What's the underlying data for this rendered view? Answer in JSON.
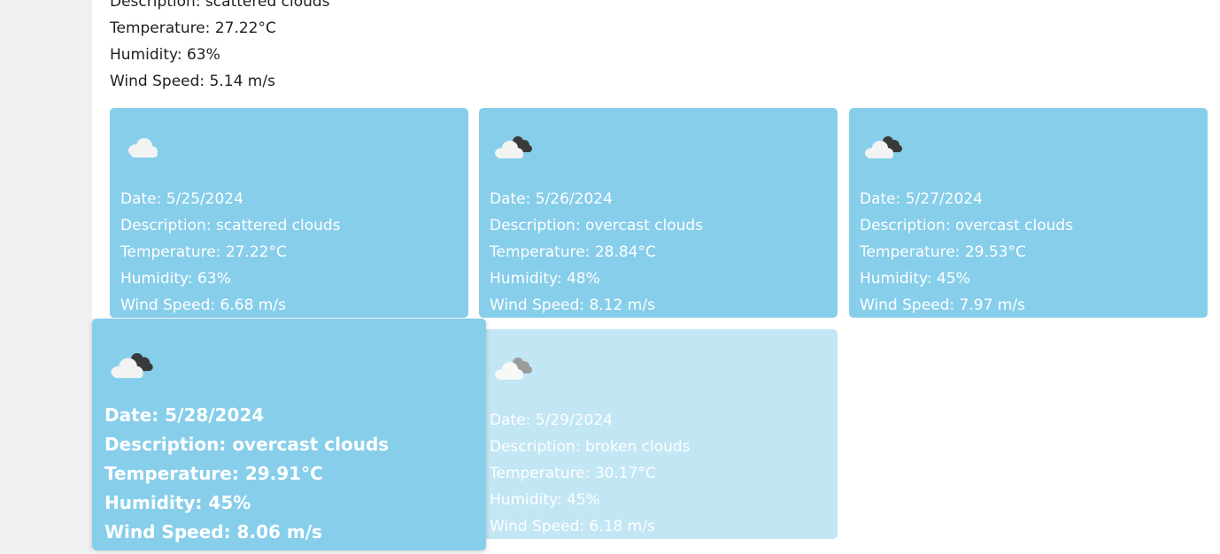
{
  "current": {
    "description": "Description: scattered clouds",
    "temperature": "Temperature: 27.22°C",
    "humidity": "Humidity: 63%",
    "wind": "Wind Speed: 5.14 m/s"
  },
  "forecast": [
    {
      "icon": "scattered-clouds-icon",
      "date": "Date: 5/25/2024",
      "description": "Description: scattered clouds",
      "temperature": "Temperature: 27.22°C",
      "humidity": "Humidity: 63%",
      "wind": "Wind Speed: 6.68 m/s"
    },
    {
      "icon": "overcast-clouds-icon",
      "date": "Date: 5/26/2024",
      "description": "Description: overcast clouds",
      "temperature": "Temperature: 28.84°C",
      "humidity": "Humidity: 48%",
      "wind": "Wind Speed: 8.12 m/s"
    },
    {
      "icon": "overcast-clouds-icon",
      "date": "Date: 5/27/2024",
      "description": "Description: overcast clouds",
      "temperature": "Temperature: 29.53°C",
      "humidity": "Humidity: 45%",
      "wind": "Wind Speed: 7.97 m/s"
    },
    {
      "icon": "overcast-clouds-icon",
      "date": "Date: 5/28/2024",
      "description": "Description: overcast clouds",
      "temperature": "Temperature: 29.91°C",
      "humidity": "Humidity: 45%",
      "wind": "Wind Speed: 8.06 m/s"
    },
    {
      "icon": "broken-clouds-icon",
      "date": "Date: 5/29/2024",
      "description": "Description: broken clouds",
      "temperature": "Temperature: 30.17°C",
      "humidity": "Humidity: 45%",
      "wind": "Wind Speed: 6.18 m/s"
    }
  ],
  "colors": {
    "card_bg": "#87ceeb",
    "card_text": "#ffffff",
    "page_text": "#1f1f1f"
  }
}
